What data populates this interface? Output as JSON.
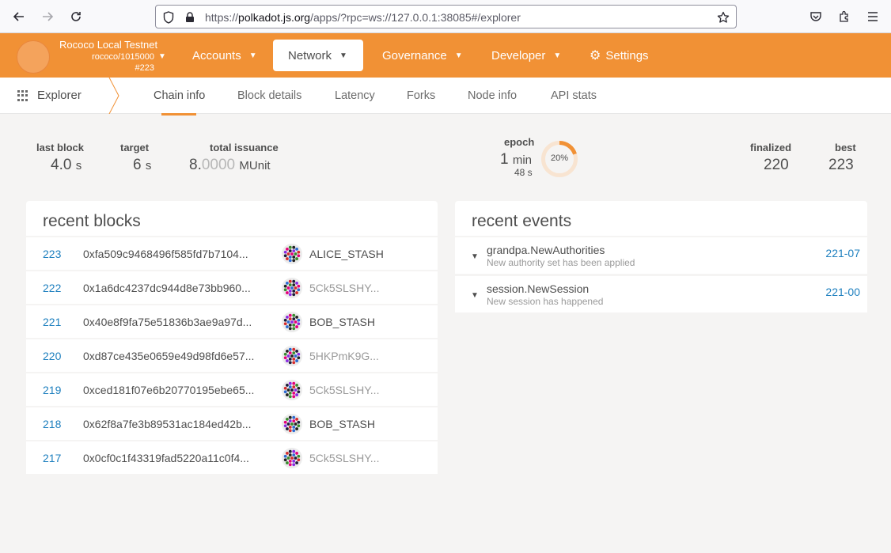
{
  "browser": {
    "url_prefix": "https://",
    "url_host": "polkadot.js.org",
    "url_rest": "/apps/?rpc=ws://127.0.0.1:38085#/explorer"
  },
  "chain": {
    "name": "Rococo Local Testnet",
    "spec": "rococo/1015000",
    "block": "#223"
  },
  "menu": {
    "accounts": "Accounts",
    "network": "Network",
    "governance": "Governance",
    "developer": "Developer",
    "settings": "Settings"
  },
  "subnav": {
    "section": "Explorer",
    "tabs": [
      "Chain info",
      "Block details",
      "Latency",
      "Forks",
      "Node info",
      "API stats"
    ]
  },
  "summary": {
    "last_block_label": "last block",
    "last_block_value": "4.0",
    "last_block_unit": "s",
    "target_label": "target",
    "target_value": "6",
    "target_unit": "s",
    "issuance_label": "total issuance",
    "issuance_int": "8.",
    "issuance_frac": "0000",
    "issuance_unit": "MUnit",
    "epoch_label": "epoch",
    "epoch_min": "1",
    "epoch_min_unit": "min",
    "epoch_sec": "48 s",
    "epoch_percent_text": "20%",
    "epoch_progress": 0.2,
    "finalized_label": "finalized",
    "finalized_value": "220",
    "best_label": "best",
    "best_value": "223"
  },
  "recent_blocks": {
    "title": "recent blocks",
    "rows": [
      {
        "number": "223",
        "hash": "0xfa509c9468496f585fd7b7104...",
        "author": "ALICE_STASH",
        "named": true
      },
      {
        "number": "222",
        "hash": "0x1a6dc4237dc944d8e73bb960...",
        "author": "5Ck5SLSHY...",
        "named": false
      },
      {
        "number": "221",
        "hash": "0x40e8f9fa75e51836b3ae9a97d...",
        "author": "BOB_STASH",
        "named": true
      },
      {
        "number": "220",
        "hash": "0xd87ce435e0659e49d98fd6e57...",
        "author": "5HKPmK9G...",
        "named": false
      },
      {
        "number": "219",
        "hash": "0xced181f07e6b20770195ebe65...",
        "author": "5Ck5SLSHY...",
        "named": false
      },
      {
        "number": "218",
        "hash": "0x62f8a7fe3b89531ac184ed42b...",
        "author": "BOB_STASH",
        "named": true
      },
      {
        "number": "217",
        "hash": "0x0cf0c1f43319fad5220a11c0f4...",
        "author": "5Ck5SLSHY...",
        "named": false
      }
    ]
  },
  "recent_events": {
    "title": "recent events",
    "rows": [
      {
        "name": "grandpa.NewAuthorities",
        "desc": "New authority set has been applied",
        "ref": "221-07"
      },
      {
        "name": "session.NewSession",
        "desc": "New session has happened",
        "ref": "221-00"
      }
    ]
  },
  "colors": {
    "accent": "#f19135",
    "link": "#1f80bf"
  }
}
